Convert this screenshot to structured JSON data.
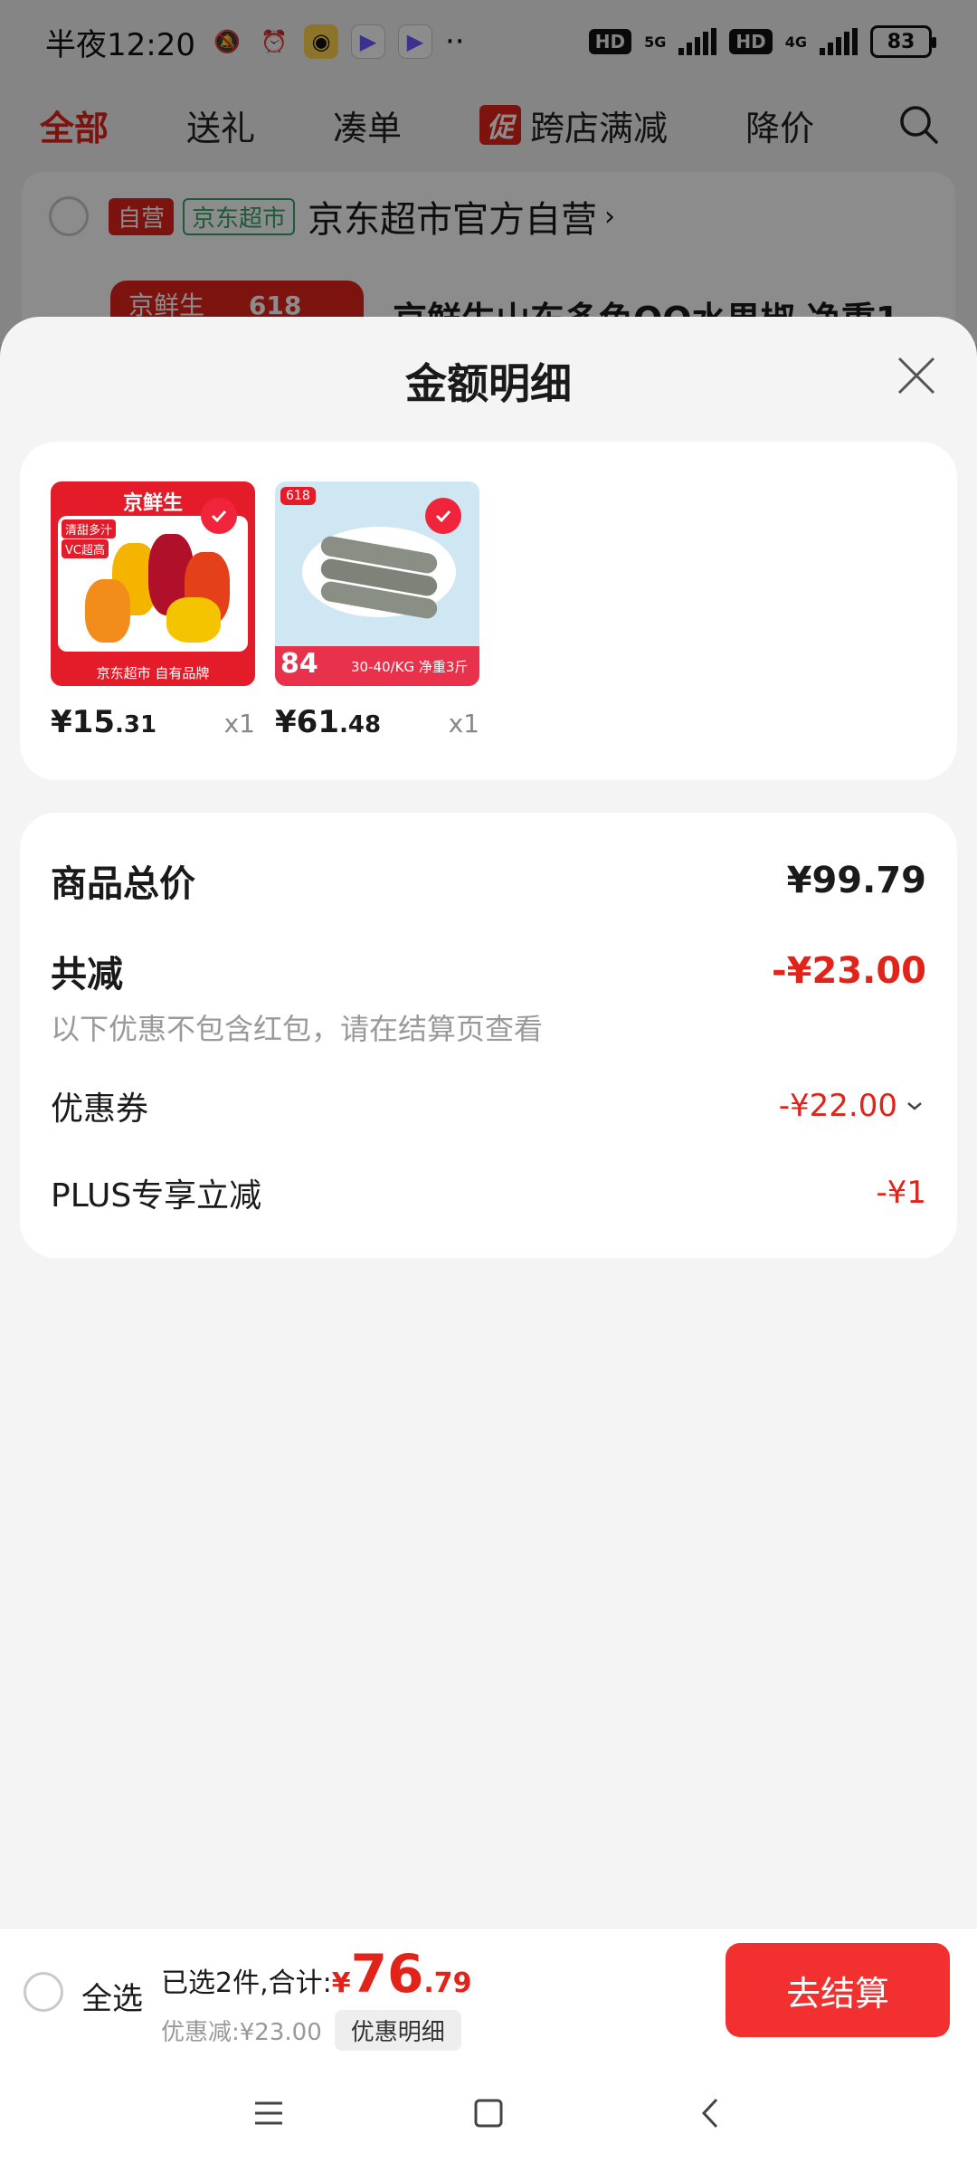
{
  "status_bar": {
    "time": "半夜12:20",
    "net1": "5G",
    "net2": "4G",
    "hd": "HD",
    "battery": "83"
  },
  "top_nav": {
    "tabs": [
      "全部",
      "送礼",
      "凑单",
      "跨店满减",
      "降价"
    ],
    "promo_badge": "促"
  },
  "store": {
    "tag_self": "自营",
    "tag_jd": "京东超市",
    "name": "京东超市官方自营",
    "item_brand": "京鲜生",
    "item_badge": "618",
    "item_title": "京鲜生山东多色QQ水果椒 净重1"
  },
  "sheet": {
    "title": "金额明细",
    "products": [
      {
        "price_int": "¥15",
        "price_dec": ".31",
        "qty": "x1",
        "img_brand": "京鲜生",
        "img_footer": "京东超市 自有品牌",
        "img_tags": [
          "清甜多汁",
          "VC超高"
        ]
      },
      {
        "price_int": "¥61",
        "price_dec": ".48",
        "qty": "x1",
        "img_badge": "618",
        "img_price": "84",
        "img_footer": "30-40/KG  净重3斤"
      }
    ],
    "summary": {
      "total_label": "商品总价",
      "total_value": "¥99.79",
      "reduce_label": "共减",
      "reduce_value": "-¥23.00",
      "note": "以下优惠不包含红包，请在结算页查看",
      "coupon_label": "优惠券",
      "coupon_value": "-¥22.00",
      "plus_label": "PLUS专享立减",
      "plus_value": "-¥1"
    }
  },
  "bottom_bar": {
    "select_all": "全选",
    "selected_text": "已选2件,合计:",
    "total_yen": "¥",
    "total_int": "76",
    "total_dec": ".79",
    "discount_text": "优惠减:¥23.00",
    "detail_button": "优惠明细",
    "checkout_button": "去结算"
  },
  "colors": {
    "accent": "#e2231a",
    "checkout": "#f23030",
    "green_tag": "#37a36b"
  }
}
